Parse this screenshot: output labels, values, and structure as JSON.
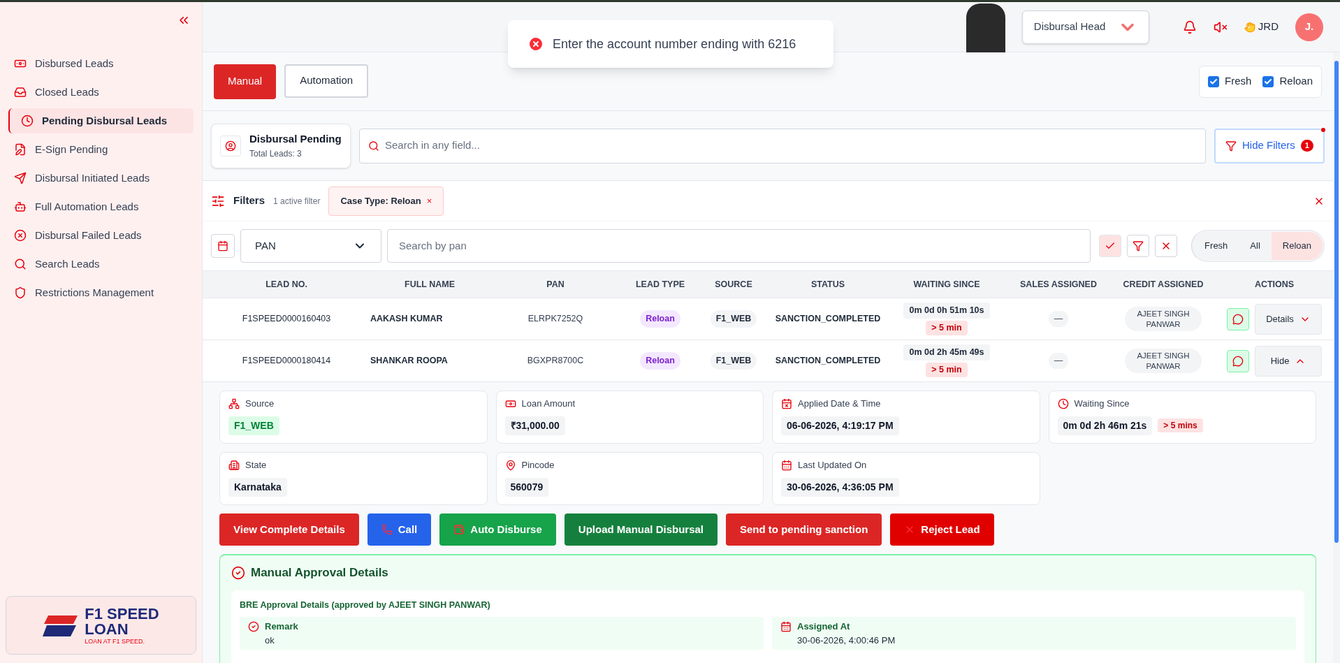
{
  "sidebar": {
    "items": [
      {
        "label": "Disbursed Leads",
        "kind": "money",
        "selected": false
      },
      {
        "label": "Closed Leads",
        "kind": "inbox",
        "selected": false
      },
      {
        "label": "Pending Disbursal Leads",
        "kind": "clock",
        "selected": true
      },
      {
        "label": "E-Sign Pending",
        "kind": "sign",
        "selected": false
      },
      {
        "label": "Disbursal Initiated Leads",
        "kind": "send",
        "selected": false
      },
      {
        "label": "Full Automation Leads",
        "kind": "bot",
        "selected": false
      },
      {
        "label": "Disbursal Failed Leads",
        "kind": "failed",
        "selected": false
      },
      {
        "label": "Search Leads",
        "kind": "search",
        "selected": false
      },
      {
        "label": "Restrictions Management",
        "kind": "shield",
        "selected": false
      }
    ],
    "logo": {
      "brand_top": "F1 SPEED",
      "brand_bottom": "LOAN",
      "tagline": "LOAN AT F1 SPEED."
    }
  },
  "header": {
    "role": "Disbursal Head",
    "user": "JRD",
    "avatar": "J."
  },
  "toast": {
    "message": "Enter the account number ending with 6216"
  },
  "mode_tabs": [
    {
      "label": "Manual",
      "selected": true
    },
    {
      "label": "Automation",
      "selected": false
    }
  ],
  "type_checks": [
    {
      "label": "Fresh",
      "checked": true
    },
    {
      "label": "Reloan",
      "checked": true
    }
  ],
  "summary": {
    "title": "Disbursal Pending",
    "subtitle": "Total Leads: 3"
  },
  "search": {
    "placeholder": "Search in any field..."
  },
  "hide_filters": {
    "label": "Hide Filters",
    "count": "1"
  },
  "filters": {
    "title": "Filters",
    "note": "1 active filter",
    "chips": [
      {
        "label": "Case Type: Reloan",
        "remove": "×"
      }
    ]
  },
  "field_search": {
    "field": "PAN",
    "placeholder": "Search by pan"
  },
  "segments": [
    {
      "label": "Fresh",
      "selected": false
    },
    {
      "label": "All",
      "selected": false
    },
    {
      "label": "Reloan",
      "selected": true
    }
  ],
  "table": {
    "columns": [
      "LEAD NO.",
      "FULL NAME",
      "PAN",
      "LEAD TYPE",
      "SOURCE",
      "STATUS",
      "WAITING SINCE",
      "SALES ASSIGNED",
      "CREDIT ASSIGNED",
      "ACTIONS"
    ],
    "rows": [
      {
        "lead_no": "F1SPEED0000160403",
        "name": "AAKASH KUMAR",
        "pan": "ELRPK7252Q",
        "lead_type": "Reloan",
        "source": "F1_WEB",
        "status": "SANCTION_COMPLETED",
        "waiting": "0m 0d 0h 51m 10s",
        "waiting_flag": "> 5 min",
        "sales": "—",
        "credit": "AJEET SINGH PANWAR",
        "action": "Details",
        "expanded": false
      },
      {
        "lead_no": "F1SPEED0000180414",
        "name": "SHANKAR ROOPA",
        "pan": "BGXPR8700C",
        "lead_type": "Reloan",
        "source": "F1_WEB",
        "status": "SANCTION_COMPLETED",
        "waiting": "0m 0d 2h 45m 49s",
        "waiting_flag": "> 5 min",
        "sales": "—",
        "credit": "AJEET SINGH PANWAR",
        "action": "Hide",
        "expanded": true
      }
    ]
  },
  "details": [
    {
      "label": "Source",
      "value": "F1_WEB",
      "kind": "source"
    },
    {
      "label": "Loan Amount",
      "value": "₹31,000.00",
      "kind": "amount"
    },
    {
      "label": "Applied Date & Time",
      "value": "06-06-2026, 4:19:17 PM",
      "kind": "applied"
    },
    {
      "label": "Waiting Since",
      "value": "0m 0d 2h 46m 21s",
      "flag": "> 5 mins",
      "kind": "waiting"
    },
    {
      "label": "State",
      "value": "Karnataka",
      "kind": "state"
    },
    {
      "label": "Pincode",
      "value": "560079",
      "kind": "pincode"
    },
    {
      "label": "Last Updated On",
      "value": "30-06-2026, 4:36:05 PM",
      "kind": "updated"
    }
  ],
  "actions": [
    {
      "label": "View Complete Details",
      "kind": "view",
      "color": "#dc2626"
    },
    {
      "label": "Call",
      "kind": "call",
      "color": "#2563eb"
    },
    {
      "label": "Auto Disburse",
      "kind": "auto",
      "color": "#16a34a"
    },
    {
      "label": "Upload Manual Disbursal",
      "kind": "upload",
      "color": "#15803d"
    },
    {
      "label": "Send to pending sanction",
      "kind": "send",
      "color": "#dc2626"
    },
    {
      "label": "Reject Lead",
      "kind": "reject",
      "color": "#e00000"
    }
  ],
  "approval": {
    "title": "Manual Approval Details",
    "subtitle": "BRE Approval Details (approved by AJEET SINGH PANWAR)",
    "fields": [
      {
        "label": "Remark",
        "value": "ok",
        "kind": "remark"
      },
      {
        "label": "Assigned At",
        "value": "30-06-2026, 4:00:46 PM",
        "kind": "assigned"
      }
    ]
  }
}
